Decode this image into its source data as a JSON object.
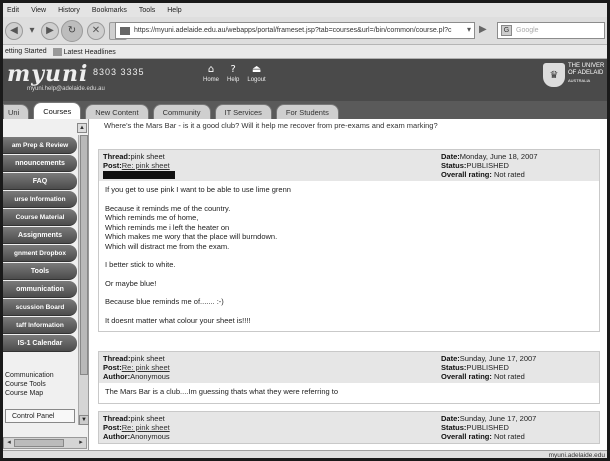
{
  "menu": [
    "Edit",
    "View",
    "History",
    "Bookmarks",
    "Tools",
    "Help"
  ],
  "nav": {
    "back_icon": "back-arrow-icon",
    "forward_icon": "forward-arrow-icon",
    "url": "https://myuni.adelaide.edu.au/webapps/portal/frameset.jsp?tab=courses&url=/bin/common/course.pl?c",
    "search_placeholder": "Google"
  },
  "bookmarks": [
    "etting Started",
    "Latest Headlines"
  ],
  "header": {
    "logo": "myuni",
    "email": "myuni.help@adelaide.edu.au",
    "phone": "8303 3335",
    "links": [
      {
        "label": "Home",
        "icon": "home-icon"
      },
      {
        "label": "Help",
        "icon": "help-icon"
      },
      {
        "label": "Logout",
        "icon": "logout-icon"
      }
    ],
    "uni_name": [
      "THE UNIVER",
      "OF ADELAID",
      "AUSTRALIA"
    ]
  },
  "tabs": [
    "Uni",
    "Courses",
    "New Content",
    "Community",
    "IT Services",
    "For Students"
  ],
  "active_tab": "Courses",
  "sidebar": {
    "items": [
      "am Prep & Review",
      "nnouncements",
      "FAQ",
      "urse Information",
      "Course Material",
      "Assignments",
      "gnment Dropbox",
      "Tools",
      "ommunication",
      "scussion Board",
      "taff Information",
      "IS-1 Calendar"
    ],
    "links": [
      "Communication",
      "Course Tools",
      "Course Map"
    ],
    "control_panel": "Control Panel"
  },
  "content": {
    "prev_line": "Where's the Mars Bar - is it a good club? Will it help me recover from pre-exams and exam marking?",
    "posts": [
      {
        "thread_label": "Thread:",
        "thread": "pink sheet",
        "post_label": "Post:",
        "post": "Re: pink sheet",
        "author_label": "",
        "author": "",
        "date_label": "Date:",
        "date": "Monday, June 18, 2007",
        "status_label": "Status:",
        "status": "PUBLISHED",
        "rating_label": "Overall rating:",
        "rating": "Not rated",
        "body": [
          [
            "If you get to use pink I want to be able to use lime grenn"
          ],
          [
            "Because it reminds me of the country.",
            "Which reminds me of home,",
            "Which reminds me i left the heater on",
            "Which makes me wory that the place will burndown.",
            "Which will distract me from the exam."
          ],
          [
            "I better stick to white."
          ],
          [
            "Or maybe blue!"
          ],
          [
            "Because blue reminds me of....... :-)"
          ],
          [
            "It doesnt matter what colour your sheet is!!!!"
          ]
        ]
      },
      {
        "thread_label": "Thread:",
        "thread": "pink sheet",
        "post_label": "Post:",
        "post": "Re: pink sheet",
        "author_label": "Author:",
        "author": "Anonymous",
        "date_label": "Date:",
        "date": "Sunday, June 17, 2007",
        "status_label": "Status:",
        "status": "PUBLISHED",
        "rating_label": "Overall rating:",
        "rating": "Not rated",
        "body": [
          [
            "The Mars Bar is a club....Im guessing thats what they were referring to"
          ]
        ]
      },
      {
        "thread_label": "Thread:",
        "thread": "pink sheet",
        "post_label": "Post:",
        "post": "Re: pink sheet",
        "author_label": "Author:",
        "author": "Anonymous",
        "date_label": "Date:",
        "date": "Sunday, June 17, 2007",
        "status_label": "Status:",
        "status": "PUBLISHED",
        "rating_label": "Overall rating:",
        "rating": "Not rated",
        "body": []
      }
    ]
  },
  "status_bar": "myuni.adelaide.edu"
}
